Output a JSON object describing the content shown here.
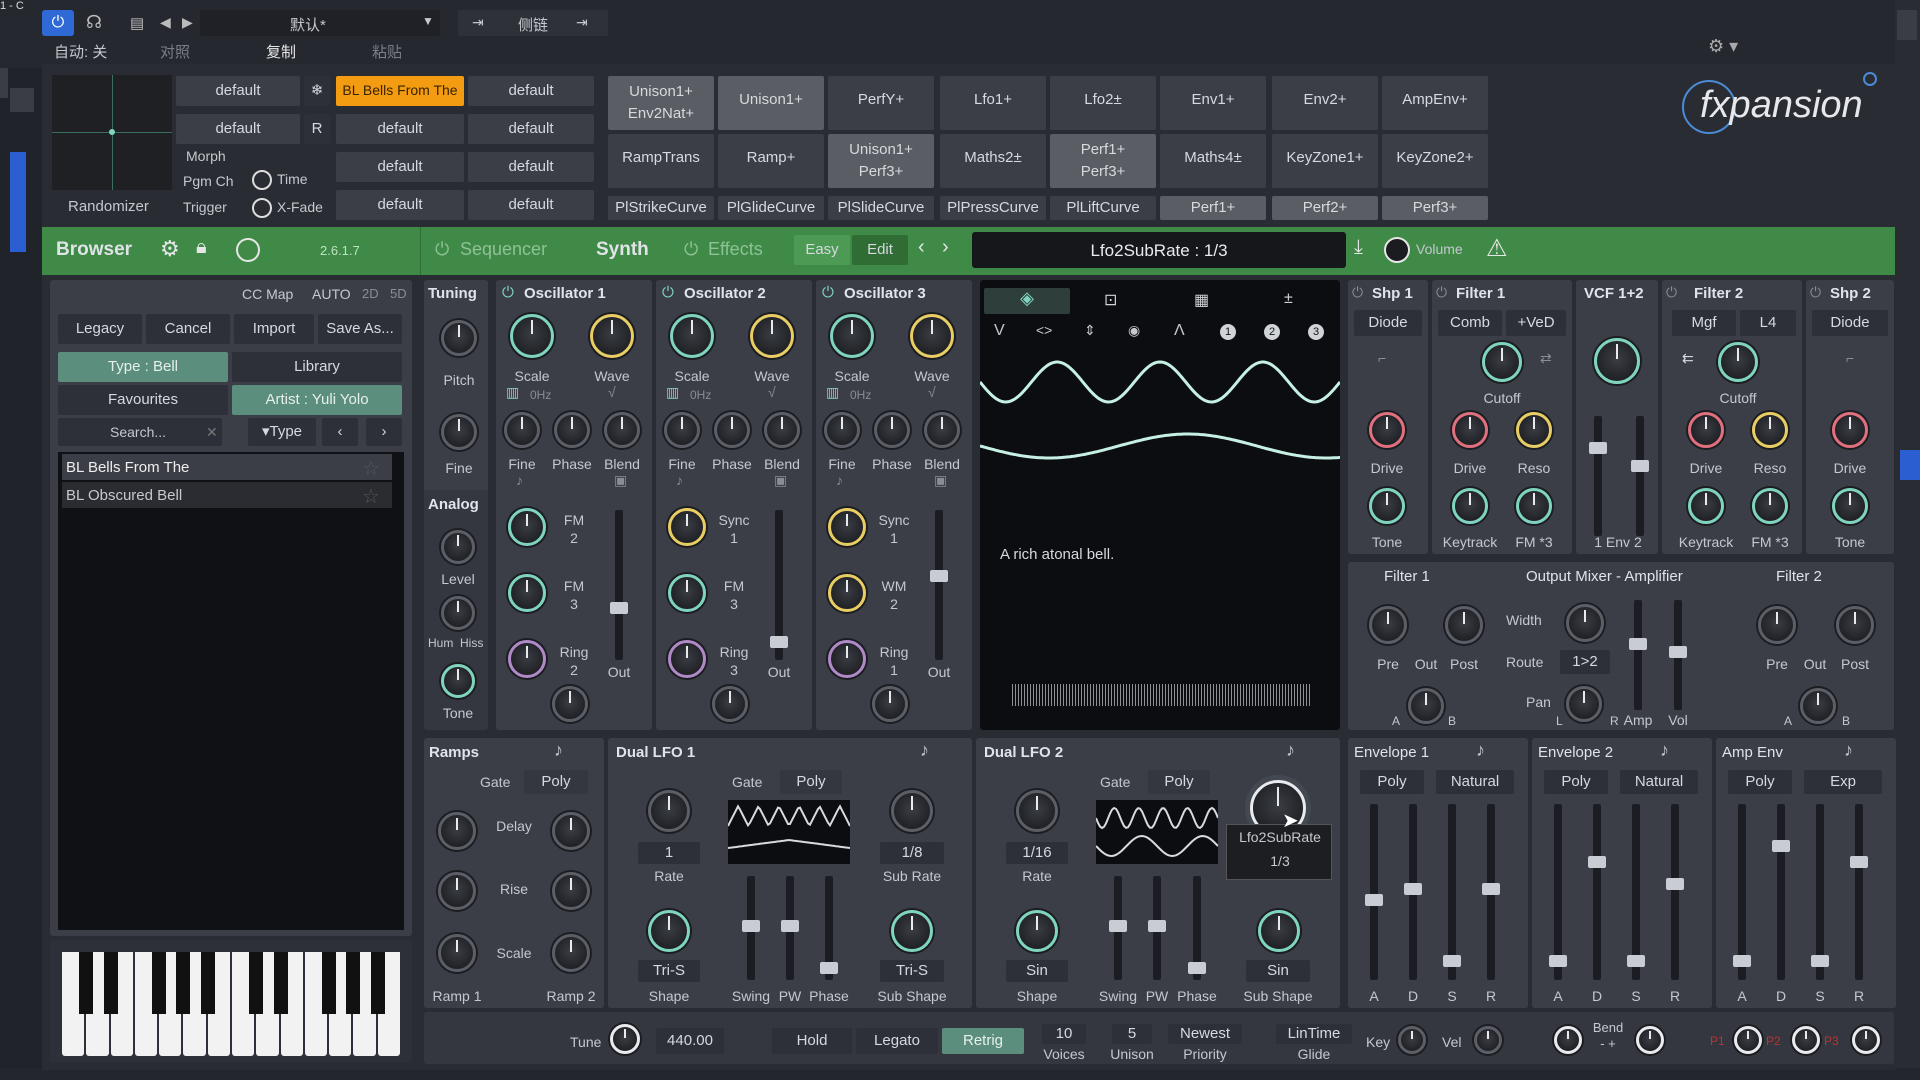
{
  "host": {
    "title_fragment": "1 - C",
    "preset_name": "默认*",
    "auto_label": "自动: 关",
    "compare": "对照",
    "copy": "复制",
    "paste": "粘贴",
    "sidechain": "侧链"
  },
  "macros": {
    "col1": [
      "default",
      "default"
    ],
    "col2": [
      "BL Bells From The",
      "default",
      "default",
      "default"
    ],
    "col3": [
      "default",
      "default",
      "default",
      "default"
    ],
    "morph": "Morph",
    "pgm_ch": "Pgm Ch",
    "trigger": "Trigger",
    "time": "Time",
    "xfade": "X-Fade",
    "randomizer": "Randomizer",
    "snowflake": "❄",
    "r_badge": "R"
  },
  "mod_grid": {
    "row1": [
      [
        "Unison1+",
        "Env2Nat+"
      ],
      [
        "Unison1+",
        ""
      ],
      [
        "PerfY+",
        ""
      ],
      [
        "Lfo1+",
        ""
      ],
      [
        "Lfo2±",
        ""
      ],
      [
        "Env1+",
        ""
      ],
      [
        "Env2+",
        ""
      ],
      [
        "AmpEnv+",
        ""
      ]
    ],
    "row2": [
      [
        "RampTrans",
        ""
      ],
      [
        "Ramp+",
        ""
      ],
      [
        "Unison1+",
        "Perf3+"
      ],
      [
        "Maths2±",
        ""
      ],
      [
        "Perf1+",
        "Perf3+"
      ],
      [
        "Maths4±",
        ""
      ],
      [
        "KeyZone1+",
        ""
      ],
      [
        "KeyZone2+",
        ""
      ]
    ],
    "row3": [
      "PlStrikeCurve",
      "PlGlideCurve",
      "PlSlideCurve",
      "PlPressCurve",
      "PlLiftCurve",
      "Perf1+",
      "Perf2+",
      "Perf3+"
    ]
  },
  "logo": "fxpansion",
  "toolbar": {
    "browser": "Browser",
    "version": "2.6.1.7",
    "sequencer": "Sequencer",
    "synth": "Synth",
    "effects": "Effects",
    "easy": "Easy",
    "edit": "Edit",
    "display": "Lfo2SubRate : 1/3",
    "volume": "Volume"
  },
  "browser": {
    "cc_map": "CC Map",
    "auto": "AUTO",
    "d2": "2D",
    "d5": "5D",
    "legacy": "Legacy",
    "cancel": "Cancel",
    "import": "Import",
    "save_as": "Save As...",
    "type_bell": "Type : Bell",
    "library": "Library",
    "favourites": "Favourites",
    "artist": "Artist : Yuli Yolo",
    "search": "Search...",
    "type": "▾Type",
    "presets": [
      "BL Bells From The",
      "BL Obscured Bell"
    ]
  },
  "tuning": {
    "title": "Tuning",
    "pitch": "Pitch",
    "fine": "Fine",
    "analog": "Analog",
    "level": "Level",
    "hum": "Hum",
    "hiss": "Hiss",
    "tone": "Tone"
  },
  "osc": [
    {
      "title": "Oscillator 1",
      "scale": "Scale",
      "wave": "Wave",
      "hz": "0Hz",
      "fine": "Fine",
      "phase": "Phase",
      "blend": "Blend",
      "m1": "FM",
      "m1n": "2",
      "m2": "FM",
      "m2n": "3",
      "m3": "Ring",
      "m3n": "2",
      "out": "Out"
    },
    {
      "title": "Oscillator 2",
      "scale": "Scale",
      "wave": "Wave",
      "hz": "0Hz",
      "fine": "Fine",
      "phase": "Phase",
      "blend": "Blend",
      "m1": "Sync",
      "m1n": "1",
      "m2": "FM",
      "m2n": "3",
      "m3": "Ring",
      "m3n": "3",
      "out": "Out"
    },
    {
      "title": "Oscillator 3",
      "scale": "Scale",
      "wave": "Wave",
      "hz": "0Hz",
      "fine": "Fine",
      "phase": "Phase",
      "blend": "Blend",
      "m1": "Sync",
      "m1n": "1",
      "m2": "WM",
      "m2n": "2",
      "m3": "Ring",
      "m3n": "1",
      "out": "Out"
    }
  ],
  "display": {
    "description": "A rich atonal bell.",
    "n1": "1",
    "n2": "2",
    "n3": "3"
  },
  "filters": {
    "shp1": "Shp 1",
    "diode": "Diode",
    "filter1": "Filter 1",
    "comb": "Comb",
    "ved": "+VeD",
    "vcf": "VCF 1+2",
    "filter2": "Filter 2",
    "mgf": "Mgf",
    "l4": "L4",
    "shp2": "Shp 2",
    "diode2": "Diode",
    "cutoff": "Cutoff",
    "drive": "Drive",
    "reso": "Reso",
    "tone": "Tone",
    "keytrack": "Keytrack",
    "fm3": "FM *3",
    "env2": "1 Env 2"
  },
  "mixer": {
    "filter1": "Filter 1",
    "title": "Output Mixer - Amplifier",
    "filter2": "Filter 2",
    "pre": "Pre",
    "out": "Out",
    "post": "Post",
    "width": "Width",
    "route": "Route",
    "route_val": "1>2",
    "pan": "Pan",
    "amp": "Amp",
    "vol": "Vol",
    "a": "A",
    "b": "B",
    "l": "L",
    "r": "R"
  },
  "ramps": {
    "title": "Ramps",
    "gate": "Gate",
    "poly": "Poly",
    "delay": "Delay",
    "rise": "Rise",
    "scale": "Scale",
    "ramp1": "Ramp 1",
    "ramp2": "Ramp 2"
  },
  "lfo1": {
    "title": "Dual LFO 1",
    "gate": "Gate",
    "poly": "Poly",
    "rate_val": "1",
    "rate": "Rate",
    "sub_val": "1/8",
    "sub_rate": "Sub Rate",
    "shape_val": "Tri-S",
    "shape": "Shape",
    "swing": "Swing",
    "pw": "PW",
    "phase": "Phase",
    "sub_shape_val": "Tri-S",
    "sub_shape": "Sub Shape"
  },
  "lfo2": {
    "title": "Dual LFO 2",
    "gate": "Gate",
    "poly": "Poly",
    "rate_val": "1/16",
    "rate": "Rate",
    "shape_val": "Sin",
    "shape": "Shape",
    "swing": "Swing",
    "pw": "PW",
    "phase": "Phase",
    "sub_shape_val": "Sin",
    "sub_shape": "Sub Shape",
    "tooltip1": "Lfo2SubRate",
    "tooltip2": "1/3"
  },
  "envs": [
    {
      "title": "Envelope 1",
      "b1": "Poly",
      "b2": "Natural",
      "levels": [
        0.45,
        0.52,
        0.08,
        0.52
      ]
    },
    {
      "title": "Envelope 2",
      "b1": "Poly",
      "b2": "Natural",
      "levels": [
        0.08,
        0.68,
        0.08,
        0.55
      ]
    },
    {
      "title": "Amp Env",
      "b1": "Poly",
      "b2": "Exp",
      "levels": [
        0.08,
        0.78,
        0.08,
        0.68
      ]
    }
  ],
  "adsr": [
    "A",
    "D",
    "S",
    "R"
  ],
  "bottom": {
    "tune": "Tune",
    "freq": "440.00",
    "hold": "Hold",
    "legato": "Legato",
    "retrig": "Retrig",
    "voices_n": "10",
    "voices": "Voices",
    "unison_n": "5",
    "unison": "Unison",
    "newest": "Newest",
    "priority": "Priority",
    "lintime": "LinTime",
    "glide": "Glide",
    "key": "Key",
    "vel": "Vel",
    "bend": "Bend",
    "bend_sign": "-  +",
    "p1": "P1",
    "p2": "P2",
    "p3": "P3"
  },
  "colors": {
    "accent": "#7fd4bf",
    "brand_green": "#3f8a46",
    "orange": "#f39c12",
    "yellow": "#e7cd63",
    "red": "#e0707e"
  }
}
